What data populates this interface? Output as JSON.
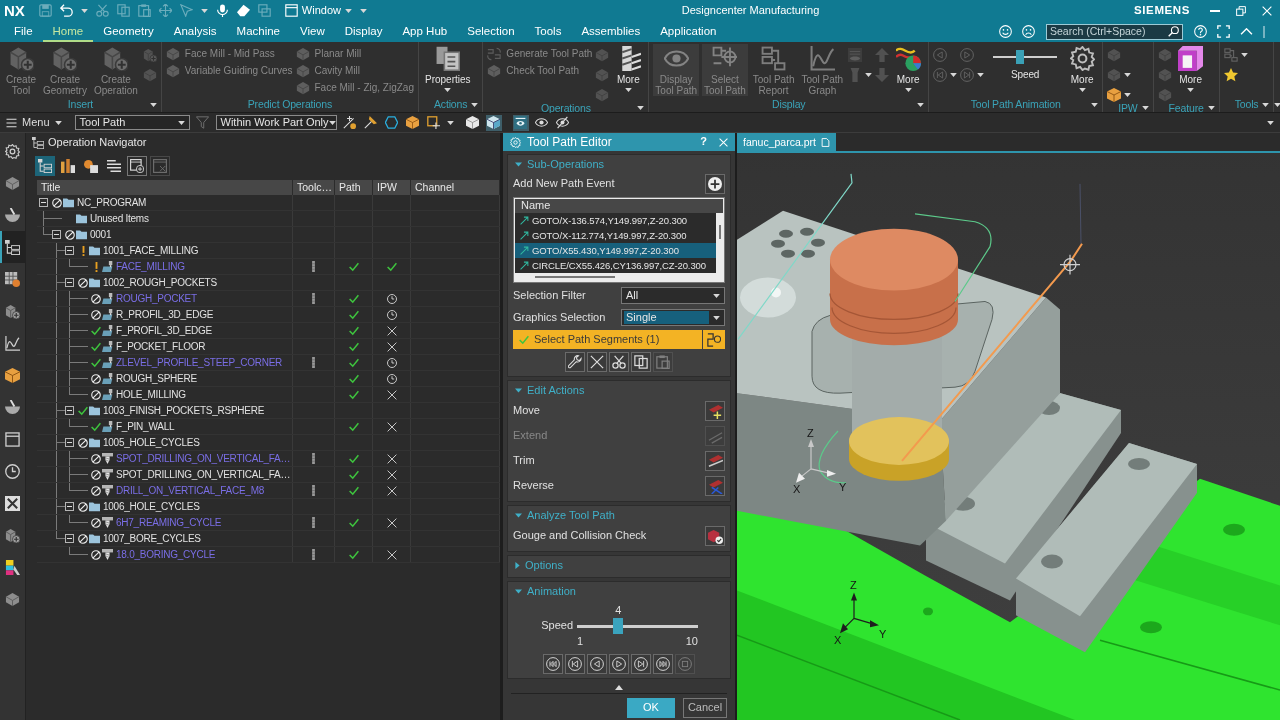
{
  "title_bar": {
    "logo": "NX",
    "quick_access": [
      {
        "disabled": true
      },
      {
        "disabled": false
      },
      {
        "disabled": true
      },
      {
        "disabled": true
      },
      {
        "disabled": true
      },
      {
        "disabled": true
      },
      {
        "disabled": true
      },
      {
        "disabled": false
      },
      {
        "disabled": false
      },
      {
        "disabled": true
      }
    ],
    "window_menu": "Window",
    "title": "Designcenter Manufacturing",
    "brand": "SIEMENS"
  },
  "menu_tabs": [
    {
      "label": "File",
      "selected": false
    },
    {
      "label": "Home",
      "selected": true
    },
    {
      "label": "Geometry",
      "selected": false
    },
    {
      "label": "Analysis",
      "selected": false
    },
    {
      "label": "Machine",
      "selected": false
    },
    {
      "label": "View",
      "selected": false
    },
    {
      "label": "Display",
      "selected": false
    },
    {
      "label": "App Hub",
      "selected": false
    },
    {
      "label": "Selection",
      "selected": false
    },
    {
      "label": "Tools",
      "selected": false
    },
    {
      "label": "Assemblies",
      "selected": false
    },
    {
      "label": "Application",
      "selected": false
    }
  ],
  "search": {
    "placeholder": "Search (Ctrl+Space)"
  },
  "ribbon": {
    "groups": [
      {
        "label": "Insert",
        "menu": true,
        "items": [
          {
            "kind": "large",
            "lines": [
              "Create",
              "Tool"
            ],
            "disabled": true,
            "dropdown": false
          },
          {
            "kind": "large",
            "lines": [
              "Create",
              "Geometry"
            ],
            "disabled": true,
            "dropdown": false
          },
          {
            "kind": "large",
            "lines": [
              "Create",
              "Operation"
            ],
            "disabled": true,
            "dropdown": false
          },
          {
            "kind": "stack",
            "buttons": [
              {
                "disabled": true,
                "dropdown": false
              },
              {
                "disabled": true,
                "dropdown": false
              }
            ]
          }
        ]
      },
      {
        "label": "Predict Operations",
        "menu": false,
        "items": [
          {
            "kind": "column",
            "entries": [
              {
                "label": "Face Mill - Mid Pass",
                "disabled": true
              },
              {
                "label": "Variable Guiding Curves",
                "disabled": true
              }
            ]
          },
          {
            "kind": "column",
            "entries": [
              {
                "label": "Planar Mill",
                "disabled": true
              },
              {
                "label": "Cavity Mill",
                "disabled": true
              },
              {
                "label": "Face Mill - Zig, ZigZag",
                "disabled": true
              }
            ]
          }
        ]
      },
      {
        "label": "Actions",
        "menu": true,
        "items": [
          {
            "kind": "large",
            "lines": [
              "Properties"
            ],
            "disabled": false,
            "dropdown": true
          }
        ]
      },
      {
        "label": "Operations",
        "menu": true,
        "items": [
          {
            "kind": "column",
            "entries": [
              {
                "label": "Generate Tool Path",
                "disabled": true
              },
              {
                "label": "Check Tool Path",
                "disabled": true
              }
            ]
          },
          {
            "kind": "stack",
            "buttons": [
              {
                "disabled": true,
                "dropdown": false
              },
              {
                "disabled": true,
                "dropdown": false
              },
              {
                "disabled": true,
                "dropdown": false
              }
            ]
          },
          {
            "kind": "large",
            "lines": [
              "More"
            ],
            "disabled": false,
            "dropdown": true
          }
        ]
      },
      {
        "label": "Display",
        "menu": true,
        "items": [
          {
            "kind": "large",
            "lines": [
              "Display",
              "Tool Path"
            ],
            "disabled": true,
            "dropdown": false,
            "pressed": true
          },
          {
            "kind": "large",
            "lines": [
              "Select",
              "Tool Path"
            ],
            "disabled": true,
            "dropdown": false,
            "pressed": true
          },
          {
            "kind": "large",
            "lines": [
              "Tool Path",
              "Report"
            ],
            "disabled": true,
            "dropdown": false,
            "pressed": false
          },
          {
            "kind": "large",
            "lines": [
              "Tool Path",
              "Graph"
            ],
            "disabled": true,
            "dropdown": false,
            "pressed": false
          },
          {
            "kind": "stack",
            "buttons": [
              {
                "disabled": true,
                "dropdown": false
              },
              {
                "disabled": true,
                "dropdown": true
              }
            ]
          },
          {
            "kind": "stack",
            "buttons": [
              {
                "disabled": true,
                "dropdown": false
              },
              {
                "disabled": true,
                "dropdown": false
              }
            ]
          },
          {
            "kind": "large",
            "lines": [
              "More"
            ],
            "disabled": false,
            "dropdown": true,
            "pressed": false
          }
        ]
      },
      {
        "label": "Tool Path Animation",
        "menu": true,
        "items": [
          {
            "kind": "stack",
            "buttons": [
              {
                "disabled": true,
                "dropdown": false
              },
              {
                "disabled": true,
                "dropdown": true
              }
            ]
          },
          {
            "kind": "stack",
            "buttons": [
              {
                "disabled": true,
                "dropdown": false
              },
              {
                "disabled": true,
                "dropdown": true
              }
            ]
          },
          {
            "kind": "slider",
            "label": "Speed",
            "level": 0.42
          },
          {
            "kind": "large",
            "lines": [
              "More"
            ],
            "disabled": false,
            "dropdown": true
          }
        ]
      },
      {
        "label": "IPW",
        "menu": true,
        "items": [
          {
            "kind": "stack",
            "buttons": [
              {
                "disabled": true,
                "dropdown": false
              },
              {
                "disabled": true,
                "dropdown": true
              },
              {
                "disabled": false,
                "dropdown": true
              }
            ]
          }
        ]
      },
      {
        "label": "Feature",
        "menu": true,
        "items": [
          {
            "kind": "stack",
            "buttons": [
              {
                "disabled": true,
                "dropdown": false
              },
              {
                "disabled": true,
                "dropdown": false
              },
              {
                "disabled": true,
                "dropdown": false
              }
            ]
          },
          {
            "kind": "large",
            "lines": [
              "More"
            ],
            "disabled": false,
            "dropdown": true
          }
        ]
      },
      {
        "label": "Tools",
        "menu": true,
        "items": [
          {
            "kind": "stack",
            "buttons": [
              {
                "disabled": true,
                "dropdown": true
              },
              {
                "disabled": false,
                "dropdown": false
              }
            ]
          }
        ]
      }
    ]
  },
  "toolbar": {
    "menu": "Menu",
    "type_filter": "Tool Path",
    "scope_filter": "Within Work Part Only",
    "tools": [
      {
        "disabled": true,
        "pressed": false
      },
      {
        "disabled": false,
        "pressed": false
      },
      {
        "disabled": false,
        "pressed": false
      },
      {
        "disabled": false,
        "pressed": false
      },
      {
        "disabled": false,
        "pressed": false
      },
      {
        "disabled": false,
        "pressed": false
      },
      {
        "disabled": false,
        "pressed": false
      },
      {
        "disabled": false,
        "pressed": true
      },
      {
        "disabled": false,
        "pressed": true
      },
      {
        "disabled": false,
        "pressed": false
      },
      {
        "disabled": false,
        "pressed": false
      }
    ]
  },
  "resource_bar": [
    {
      "selected": false
    },
    {
      "selected": false
    },
    {
      "selected": false
    },
    {
      "selected": true
    },
    {
      "selected": false
    },
    {
      "selected": false
    },
    {
      "selected": false
    },
    {
      "selected": false
    },
    {
      "selected": false
    },
    {
      "selected": false
    },
    {
      "selected": false
    },
    {
      "selected": false
    },
    {
      "selected": false
    },
    {
      "selected": false
    },
    {
      "selected": false
    }
  ],
  "navigator": {
    "title": "Operation Navigator",
    "tools": [
      {
        "selected": true,
        "disabled": false
      },
      {
        "selected": false,
        "disabled": false
      },
      {
        "selected": false,
        "disabled": false
      },
      {
        "selected": false,
        "disabled": false
      },
      {
        "selected": false,
        "disabled": false
      },
      {
        "selected": false,
        "disabled": true
      }
    ],
    "columns": [
      "Title",
      "Toolc…",
      "Path",
      "IPW",
      "Channel"
    ],
    "tree": [
      {
        "name": "NC_PROGRAM",
        "kind": "group",
        "regenerate": true,
        "complete": false,
        "warning": false,
        "expanded": true,
        "children": [
          {
            "name": "Unused Items",
            "kind": "group"
          },
          {
            "name": "0001",
            "kind": "group",
            "regenerate": true,
            "complete": false,
            "warning": false,
            "expanded": true,
            "children": [
              {
                "name": "1001_FACE_MILLING",
                "kind": "group",
                "regenerate": false,
                "complete": false,
                "warning": true,
                "expanded": true,
                "children": [
                  {
                    "name": "FACE_MILLING",
                    "kind": "milling",
                    "regenerate": false,
                    "complete": false,
                    "warning": true,
                    "highlighted": true,
                    "tool_change": true,
                    "path_done": true,
                    "ipw_done": true,
                    "ipw_pending": false,
                    "ipw_missing": false
                  }
                ]
              },
              {
                "name": "1002_ROUGH_POCKETS",
                "kind": "group",
                "regenerate": true,
                "complete": false,
                "warning": false,
                "expanded": true,
                "children": [
                  {
                    "name": "ROUGH_POCKET",
                    "kind": "milling",
                    "regenerate": true,
                    "complete": false,
                    "warning": false,
                    "highlighted": true,
                    "tool_change": true,
                    "path_done": true,
                    "ipw_done": false,
                    "ipw_pending": true,
                    "ipw_missing": false
                  },
                  {
                    "name": "R_PROFIL_3D_EDGE",
                    "kind": "milling",
                    "regenerate": true,
                    "complete": false,
                    "warning": false,
                    "highlighted": false,
                    "tool_change": false,
                    "path_done": true,
                    "ipw_done": false,
                    "ipw_pending": true,
                    "ipw_missing": false
                  },
                  {
                    "name": "F_PROFIL_3D_EDGE",
                    "kind": "milling",
                    "regenerate": false,
                    "complete": true,
                    "warning": false,
                    "highlighted": false,
                    "tool_change": false,
                    "path_done": true,
                    "ipw_done": false,
                    "ipw_pending": false,
                    "ipw_missing": true
                  },
                  {
                    "name": "F_POCKET_FLOOR",
                    "kind": "milling",
                    "regenerate": false,
                    "complete": true,
                    "warning": false,
                    "highlighted": false,
                    "tool_change": false,
                    "path_done": true,
                    "ipw_done": false,
                    "ipw_pending": false,
                    "ipw_missing": true
                  },
                  {
                    "name": "ZLEVEL_PROFILE_STEEP_CORNER",
                    "kind": "milling",
                    "regenerate": false,
                    "complete": true,
                    "warning": false,
                    "highlighted": true,
                    "tool_change": true,
                    "path_done": true,
                    "ipw_done": false,
                    "ipw_pending": true,
                    "ipw_missing": false
                  },
                  {
                    "name": "ROUGH_SPHERE",
                    "kind": "milling",
                    "regenerate": true,
                    "complete": false,
                    "warning": false,
                    "highlighted": false,
                    "tool_change": false,
                    "path_done": true,
                    "ipw_done": false,
                    "ipw_pending": true,
                    "ipw_missing": false
                  },
                  {
                    "name": "HOLE_MILLING",
                    "kind": "milling",
                    "regenerate": true,
                    "complete": false,
                    "warning": false,
                    "highlighted": false,
                    "tool_change": false,
                    "path_done": true,
                    "ipw_done": false,
                    "ipw_pending": false,
                    "ipw_missing": true
                  }
                ]
              },
              {
                "name": "1003_FINISH_POCKETS_RSPHERE",
                "kind": "group",
                "regenerate": false,
                "complete": true,
                "warning": false,
                "expanded": true,
                "children": [
                  {
                    "name": "F_PIN_WALL",
                    "kind": "milling",
                    "regenerate": false,
                    "complete": true,
                    "warning": false,
                    "highlighted": false,
                    "tool_change": false,
                    "path_done": true,
                    "ipw_done": false,
                    "ipw_pending": false,
                    "ipw_missing": true
                  }
                ]
              },
              {
                "name": "1005_HOLE_CYCLES",
                "kind": "group",
                "regenerate": true,
                "complete": false,
                "warning": false,
                "expanded": true,
                "children": [
                  {
                    "name": "SPOT_DRILLING_ON_VERTICAL_FA…",
                    "kind": "drilling",
                    "regenerate": true,
                    "complete": false,
                    "warning": false,
                    "highlighted": true,
                    "tool_change": true,
                    "path_done": true,
                    "ipw_done": false,
                    "ipw_pending": false,
                    "ipw_missing": true
                  },
                  {
                    "name": "SPOT_DRILLING_ON_VERTICAL_FA…",
                    "kind": "drilling",
                    "regenerate": true,
                    "complete": false,
                    "warning": false,
                    "highlighted": false,
                    "tool_change": false,
                    "path_done": true,
                    "ipw_done": false,
                    "ipw_pending": false,
                    "ipw_missing": true
                  },
                  {
                    "name": "DRILL_ON_VERTICAL_FACE_M8",
                    "kind": "drilling",
                    "regenerate": true,
                    "complete": false,
                    "warning": false,
                    "highlighted": true,
                    "tool_change": true,
                    "path_done": true,
                    "ipw_done": false,
                    "ipw_pending": false,
                    "ipw_missing": true
                  }
                ]
              },
              {
                "name": "1006_HOLE_CYCLES",
                "kind": "group",
                "regenerate": true,
                "complete": false,
                "warning": false,
                "expanded": true,
                "children": [
                  {
                    "name": "6H7_REAMING_CYCLE",
                    "kind": "drilling",
                    "regenerate": true,
                    "complete": false,
                    "warning": false,
                    "highlighted": true,
                    "tool_change": true,
                    "path_done": true,
                    "ipw_done": false,
                    "ipw_pending": false,
                    "ipw_missing": true
                  }
                ]
              },
              {
                "name": "1007_BORE_CYCLES",
                "kind": "group",
                "regenerate": true,
                "complete": false,
                "warning": false,
                "expanded": true,
                "children": [
                  {
                    "name": "18.0_BORING_CYCLE",
                    "kind": "drilling",
                    "regenerate": true,
                    "complete": false,
                    "warning": false,
                    "highlighted": true,
                    "tool_change": true,
                    "path_done": true,
                    "ipw_done": false,
                    "ipw_pending": false,
                    "ipw_missing": true
                  }
                ]
              }
            ]
          }
        ]
      }
    ]
  },
  "tool_path_editor": {
    "title": "Tool Path Editor",
    "help": "?",
    "sections": [
      {
        "kind": "sub_operations",
        "title": "Sub-Operations",
        "expanded": true,
        "add_label": "Add New Path Event",
        "list": {
          "column": "Name",
          "rows": [
            {
              "text": "GOTO/X-136.574,Y149.997,Z-20.300",
              "selected": false
            },
            {
              "text": "GOTO/X-112.774,Y149.997,Z-20.300",
              "selected": false
            },
            {
              "text": "GOTO/X55.430,Y149.997,Z-20.300",
              "selected": true
            },
            {
              "text": "CIRCLE/CX55.426,CY136.997,CZ-20.300",
              "selected": false
            }
          ]
        },
        "fields": [
          {
            "label": "Selection Filter",
            "value": "All",
            "focused": false
          },
          {
            "label": "Graphics Selection",
            "value": "Single",
            "focused": true
          }
        ],
        "select_bar": {
          "label": "Select Path Segments (1)"
        },
        "tools": [
          {
            "disabled": false
          },
          {
            "disabled": false
          },
          {
            "disabled": false
          },
          {
            "disabled": false
          },
          {
            "disabled": true
          }
        ]
      },
      {
        "kind": "actions",
        "title": "Edit Actions",
        "expanded": true,
        "rows": [
          {
            "label": "Move",
            "disabled": false
          },
          {
            "label": "Extend",
            "disabled": true
          },
          {
            "label": "Trim",
            "disabled": false
          },
          {
            "label": "Reverse",
            "disabled": false
          }
        ]
      },
      {
        "kind": "actions",
        "title": "Analyze Tool Path",
        "expanded": true,
        "rows": [
          {
            "label": "Gouge and Collision Check",
            "disabled": false
          }
        ]
      },
      {
        "kind": "options",
        "title": "Options",
        "expanded": false
      },
      {
        "kind": "animation",
        "title": "Animation",
        "expanded": true,
        "slider": {
          "label": "Speed",
          "value": "4",
          "min": "1",
          "max": "10",
          "level": 0.34
        },
        "controls": [
          {
            "disabled": false
          },
          {
            "disabled": false
          },
          {
            "disabled": false
          },
          {
            "disabled": false
          },
          {
            "disabled": false
          },
          {
            "disabled": false
          },
          {
            "disabled": true
          }
        ]
      }
    ],
    "buttons": [
      {
        "label": "OK",
        "kind": "primary"
      },
      {
        "label": "Cancel",
        "kind": "secondary"
      }
    ]
  },
  "viewport": {
    "tab": "fanuc_parca.prt",
    "triads": [
      {
        "labels": [
          "Z",
          "X",
          "Y"
        ]
      },
      {
        "labels": [
          "Z",
          "X",
          "Y"
        ]
      }
    ]
  }
}
